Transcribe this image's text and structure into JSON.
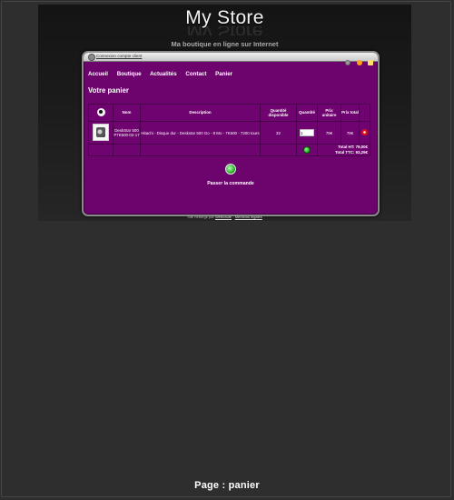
{
  "store": {
    "title": "My Store",
    "tagline": "Ma boutique en ligne sur Internet"
  },
  "topbar": {
    "login_link": "Connexion compte client",
    "icons": [
      "user-icon",
      "settings-icon",
      "help-icon",
      "cart-icon"
    ]
  },
  "nav": {
    "items": [
      "Accueil",
      "Boutique",
      "Actualités",
      "Contact",
      "Panier"
    ]
  },
  "page": {
    "heading": "Votre panier"
  },
  "cart": {
    "columns": [
      "",
      "Nom",
      "Description",
      "Quantité disponible",
      "Quantité",
      "Prix unitaire",
      "Prix total",
      ""
    ],
    "items": [
      {
        "name": "DeskStar 500 P7K500-02-17",
        "description": "Hitachi - Disque dur - Deskstar 500 Go - 8 Mo - 7K500 - 7200 tours",
        "available": "32",
        "quantity": "1",
        "unit_price": "79€",
        "total_price": "79€"
      }
    ],
    "total_ht": "Total HT: 79,00€",
    "total_ttc": "Total TTC: 93,29€"
  },
  "actions": {
    "order_label": "Passer la commande"
  },
  "footer": {
    "prefix": "Site hébergé par",
    "host_link": "Webnaute",
    "separator": " - ",
    "mentions_link": "Mentions légales"
  },
  "caption": "Page : panier",
  "colors": {
    "panel": "#6d036d",
    "background": "#2e2e2e"
  }
}
